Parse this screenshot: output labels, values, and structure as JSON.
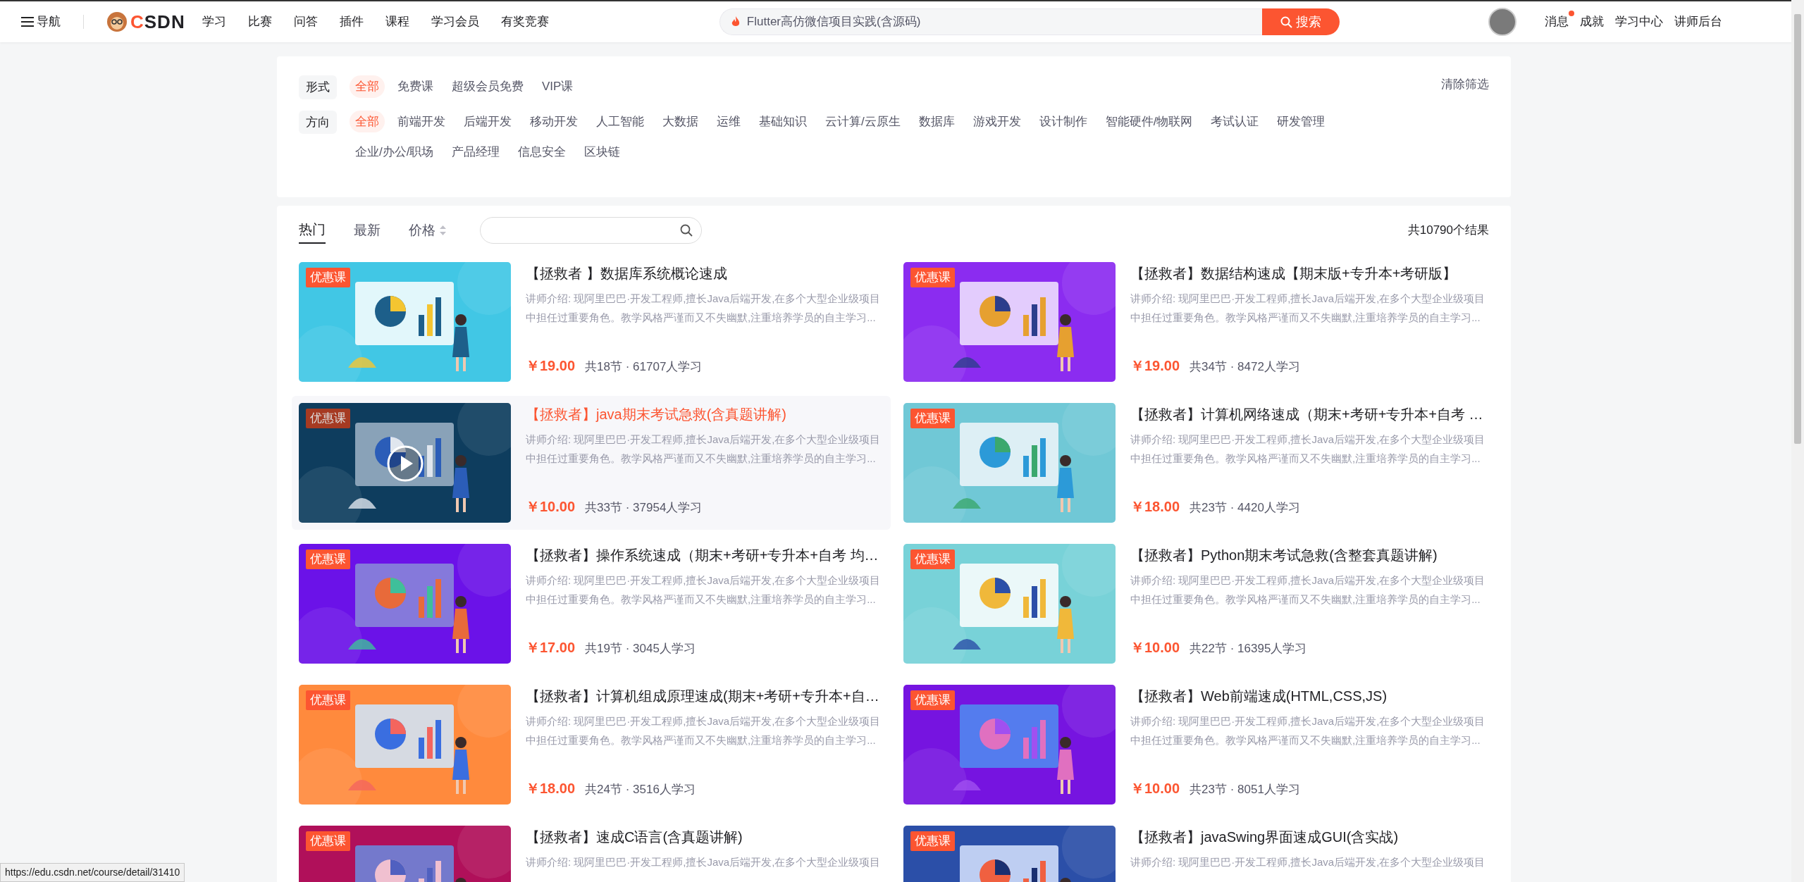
{
  "topbar": {
    "menu_label": "导航",
    "logo": "CSDN",
    "nav": [
      "学习",
      "比赛",
      "问答",
      "插件",
      "课程",
      "学习会员",
      "有奖竞赛"
    ],
    "search": {
      "placeholder": "Flutter高仿微信项目实践(含源码)",
      "button": "搜索"
    },
    "user_links": [
      {
        "label": "消息",
        "unread": true
      },
      {
        "label": "成就",
        "unread": false
      },
      {
        "label": "学习中心",
        "unread": false
      },
      {
        "label": "讲师后台",
        "unread": false
      }
    ]
  },
  "filters": {
    "rows": [
      {
        "label": "形式",
        "options": [
          {
            "label": "全部",
            "selected": true
          },
          {
            "label": "免费课",
            "selected": false
          },
          {
            "label": "超级会员免费",
            "selected": false
          },
          {
            "label": "VIP课",
            "selected": false
          }
        ]
      },
      {
        "label": "方向",
        "options": [
          {
            "label": "全部",
            "selected": true
          },
          {
            "label": "前端开发",
            "selected": false
          },
          {
            "label": "后端开发",
            "selected": false
          },
          {
            "label": "移动开发",
            "selected": false
          },
          {
            "label": "人工智能",
            "selected": false
          },
          {
            "label": "大数据",
            "selected": false
          },
          {
            "label": "运维",
            "selected": false
          },
          {
            "label": "基础知识",
            "selected": false
          },
          {
            "label": "云计算/云原生",
            "selected": false
          },
          {
            "label": "数据库",
            "selected": false
          },
          {
            "label": "游戏开发",
            "selected": false
          },
          {
            "label": "设计制作",
            "selected": false
          },
          {
            "label": "智能硬件/物联网",
            "selected": false
          },
          {
            "label": "考试认证",
            "selected": false
          },
          {
            "label": "研发管理",
            "selected": false
          },
          {
            "label": "企业/办公/职场",
            "selected": false
          },
          {
            "label": "产品经理",
            "selected": false
          },
          {
            "label": "信息安全",
            "selected": false
          },
          {
            "label": "区块链",
            "selected": false
          }
        ]
      }
    ],
    "clear": "清除筛选"
  },
  "sort_tabs": [
    {
      "label": "热门",
      "selected": true,
      "kind": "plain"
    },
    {
      "label": "最新",
      "selected": false,
      "kind": "plain"
    },
    {
      "label": "价格",
      "selected": false,
      "kind": "sortable"
    }
  ],
  "result_count": "共10790个结果",
  "courses": [
    {
      "badge": "优惠课",
      "hovered": false,
      "title": "【拯救者 】数据库系统概论速成",
      "description": "讲师介绍: 现阿里巴巴·开发工程师,擅长Java后端开发,在多个大型企业级项目中担任过重要角色。教学风格严谨而又不失幽默,注重培养学员的自主学习...",
      "price": "￥19.00",
      "meta": "共18节 · 61707人学习"
    },
    {
      "badge": "优惠课",
      "hovered": false,
      "title": "【拯救者】数据结构速成【期末版+专升本+考研版】",
      "description": "讲师介绍: 现阿里巴巴·开发工程师,擅长Java后端开发,在多个大型企业级项目中担任过重要角色。教学风格严谨而又不失幽默,注重培养学员的自主学习...",
      "price": "￥19.00",
      "meta": "共34节 · 8472人学习"
    },
    {
      "badge": "优惠课",
      "hovered": true,
      "title": "【拯救者】java期末考试急救(含真题讲解)",
      "description": "讲师介绍: 现阿里巴巴·开发工程师,擅长Java后端开发,在多个大型企业级项目中担任过重要角色。教学风格严谨而又不失幽默,注重培养学员的自主学习...",
      "price": "￥10.00",
      "meta": "共33节 · 37954人学习"
    },
    {
      "badge": "优惠课",
      "hovered": false,
      "title": "【拯救者】计算机网络速成（期末+考研+专升本+自考 …",
      "description": "讲师介绍: 现阿里巴巴·开发工程师,擅长Java后端开发,在多个大型企业级项目中担任过重要角色。教学风格严谨而又不失幽默,注重培养学员的自主学习...",
      "price": "￥18.00",
      "meta": "共23节 · 4420人学习"
    },
    {
      "badge": "优惠课",
      "hovered": false,
      "title": "【拯救者】操作系统速成（期末+考研+专升本+自考 均…",
      "description": "讲师介绍: 现阿里巴巴·开发工程师,擅长Java后端开发,在多个大型企业级项目中担任过重要角色。教学风格严谨而又不失幽默,注重培养学员的自主学习...",
      "price": "￥17.00",
      "meta": "共19节 · 3045人学习"
    },
    {
      "badge": "优惠课",
      "hovered": false,
      "title": "【拯救者】Python期末考试急救(含整套真题讲解)",
      "description": "讲师介绍: 现阿里巴巴·开发工程师,擅长Java后端开发,在多个大型企业级项目中担任过重要角色。教学风格严谨而又不失幽默,注重培养学员的自主学习...",
      "price": "￥10.00",
      "meta": "共22节 · 16395人学习"
    },
    {
      "badge": "优惠课",
      "hovered": false,
      "title": "【拯救者】计算机组成原理速成(期末+考研+专升本+自…",
      "description": "讲师介绍: 现阿里巴巴·开发工程师,擅长Java后端开发,在多个大型企业级项目中担任过重要角色。教学风格严谨而又不失幽默,注重培养学员的自主学习...",
      "price": "￥18.00",
      "meta": "共24节 · 3516人学习"
    },
    {
      "badge": "优惠课",
      "hovered": false,
      "title": "【拯救者】Web前端速成(HTML,CSS,JS)",
      "description": "讲师介绍: 现阿里巴巴·开发工程师,擅长Java后端开发,在多个大型企业级项目中担任过重要角色。教学风格严谨而又不失幽默,注重培养学员的自主学习...",
      "price": "￥10.00",
      "meta": "共23节 · 8051人学习"
    },
    {
      "badge": "优惠课",
      "hovered": false,
      "title": "【拯救者】速成C语言(含真题讲解)",
      "description": "讲师介绍: 现阿里巴巴·开发工程师,擅长Java后端开发,在多个大型企业级项目"
    },
    {
      "badge": "优惠课",
      "hovered": false,
      "title": "【拯救者】javaSwing界面速成GUI(含实战)",
      "description": "讲师介绍: 现阿里巴巴·开发工程师,擅长Java后端开发,在多个大型企业级项目"
    }
  ],
  "status_url": "https://edu.csdn.net/course/detail/31410"
}
